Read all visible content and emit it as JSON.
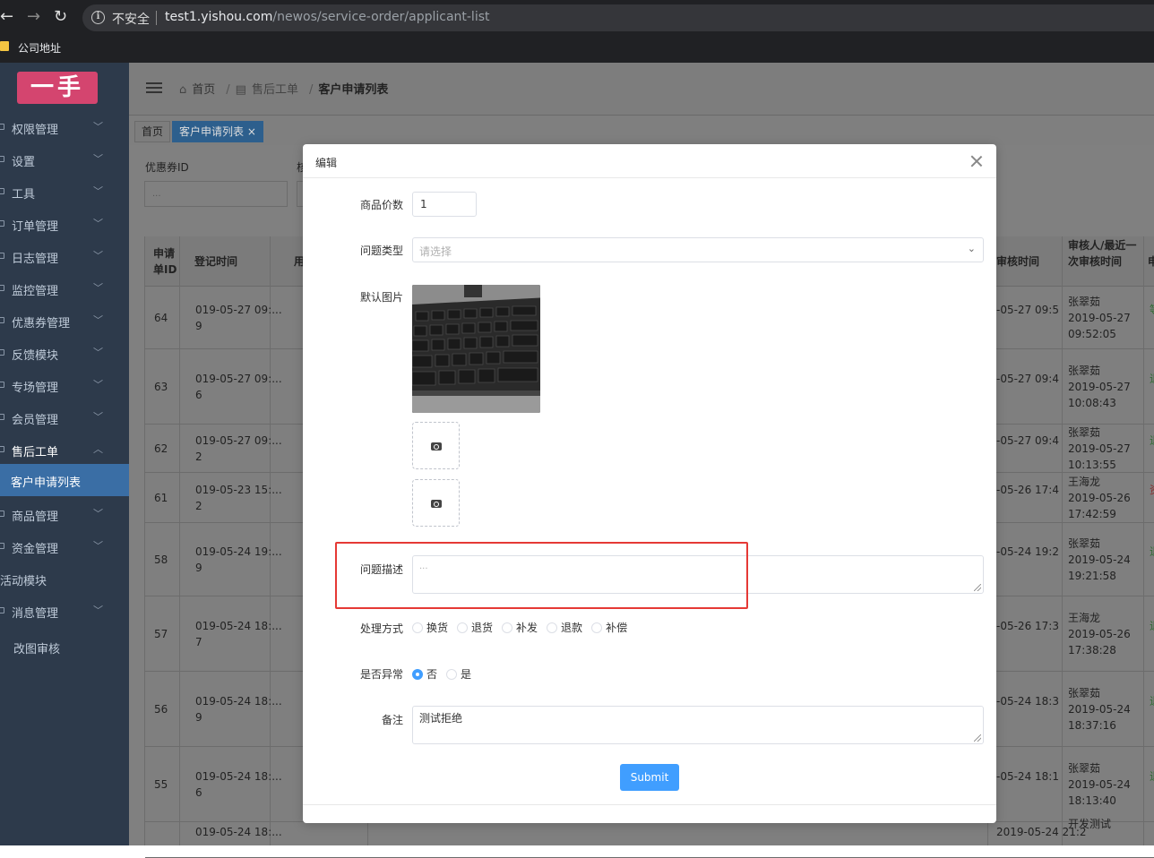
{
  "browser": {
    "insecure_label": "不安全",
    "url_host": "test1.yishou.com",
    "url_path": "/newos/service-order/applicant-list",
    "bookmark": "公司地址"
  },
  "sidebar": {
    "logo": "一手",
    "items": [
      {
        "label": "权限管理"
      },
      {
        "label": "设置"
      },
      {
        "label": "工具"
      },
      {
        "label": "订单管理"
      },
      {
        "label": "日志管理"
      },
      {
        "label": "监控管理"
      },
      {
        "label": "优惠券管理"
      },
      {
        "label": "反馈模块"
      },
      {
        "label": "专场管理"
      },
      {
        "label": "会员管理"
      },
      {
        "label": "售后工单"
      },
      {
        "label": "客户申请列表"
      },
      {
        "label": "商品管理"
      },
      {
        "label": "资金管理"
      },
      {
        "label": "活动模块"
      },
      {
        "label": "消息管理"
      },
      {
        "label": "改图审核"
      }
    ]
  },
  "breadcrumb": {
    "home": "首页",
    "section": "售后工单",
    "current": "客户申请列表"
  },
  "tags": [
    {
      "label": "首页"
    },
    {
      "label": "客户申请列表"
    }
  ],
  "filter": {
    "label": "优惠券ID",
    "placeholder": "...",
    "label2": "核"
  },
  "table": {
    "headers": {
      "id": "申请单ID",
      "time": "登记时间",
      "user": "用",
      "audit_time": "审核时间",
      "auditor": "审核人/最近一次审核时间",
      "status": "申"
    },
    "rows": [
      {
        "id": "64",
        "time1": "019-05-27 09:...",
        "time2": "9",
        "audit": "-05-27 09:5",
        "auditor": "张翠茹",
        "adate": "2019-05-27",
        "atime": "09:52:05",
        "status": "等"
      },
      {
        "id": "63",
        "time1": "019-05-27 09:...",
        "time2": "6",
        "audit": "-05-27 09:4",
        "auditor": "张翠茹",
        "adate": "2019-05-27",
        "atime": "10:08:43",
        "status": "退"
      },
      {
        "id": "62",
        "time1": "019-05-27 09:...",
        "time2": "2",
        "audit": "-05-27 09:4",
        "auditor": "张翠茹",
        "adate": "2019-05-27",
        "atime": "10:13:55",
        "status": "退"
      },
      {
        "id": "61",
        "time1": "019-05-23 15:...",
        "time2": "2",
        "audit": "-05-26 17:4",
        "auditor": "王海龙",
        "adate": "2019-05-26",
        "atime": "17:42:59",
        "status": "资"
      },
      {
        "id": "58",
        "time1": "019-05-24 19:...",
        "time2": "9",
        "audit": "-05-24 19:2",
        "auditor": "张翠茹",
        "adate": "2019-05-24",
        "atime": "19:21:58",
        "status": "退"
      },
      {
        "id": "57",
        "time1": "019-05-24 18:...",
        "time2": "7",
        "audit": "-05-26 17:3",
        "auditor": "王海龙",
        "adate": "2019-05-26",
        "atime": "17:38:28",
        "status": "退"
      },
      {
        "id": "56",
        "time1": "019-05-24 18:...",
        "time2": "9",
        "audit": "-05-24 18:3",
        "auditor": "张翠茹",
        "adate": "2019-05-24",
        "atime": "18:37:16",
        "status": "退"
      },
      {
        "id": "55",
        "time1": "019-05-24 18:...",
        "time2": "6",
        "audit": "-05-24 18:1",
        "auditor": "张翠茹",
        "adate": "2019-05-24",
        "atime": "18:13:40",
        "status": "退"
      },
      {
        "id": "",
        "time1": "019-05-24 18:...",
        "time2": "",
        "audit": "2019-05-24 21:2",
        "auditor": "开发测试",
        "adate": "",
        "atime": "",
        "status": ""
      }
    ]
  },
  "modal": {
    "title": "编辑",
    "price_label": "商品价数",
    "price_value": "1",
    "issue_type_label": "问题类型",
    "issue_type_placeholder": "请选择",
    "default_image_label": "默认图片",
    "desc_label": "问题描述",
    "desc_placeholder": "...",
    "handle_label": "处理方式",
    "handle_options": [
      "换货",
      "退货",
      "补发",
      "退款",
      "补偿"
    ],
    "abnormal_label": "是否异常",
    "abnormal_options": [
      "否",
      "是"
    ],
    "abnormal_selected": "否",
    "remark_label": "备注",
    "remark_value": "测试拒绝",
    "submit_label": "Submit"
  },
  "colors": {
    "accent": "#409eff",
    "sidebar_bg": "#2d3a4b",
    "highlight": "#e53935",
    "logo": "#d4456f"
  }
}
